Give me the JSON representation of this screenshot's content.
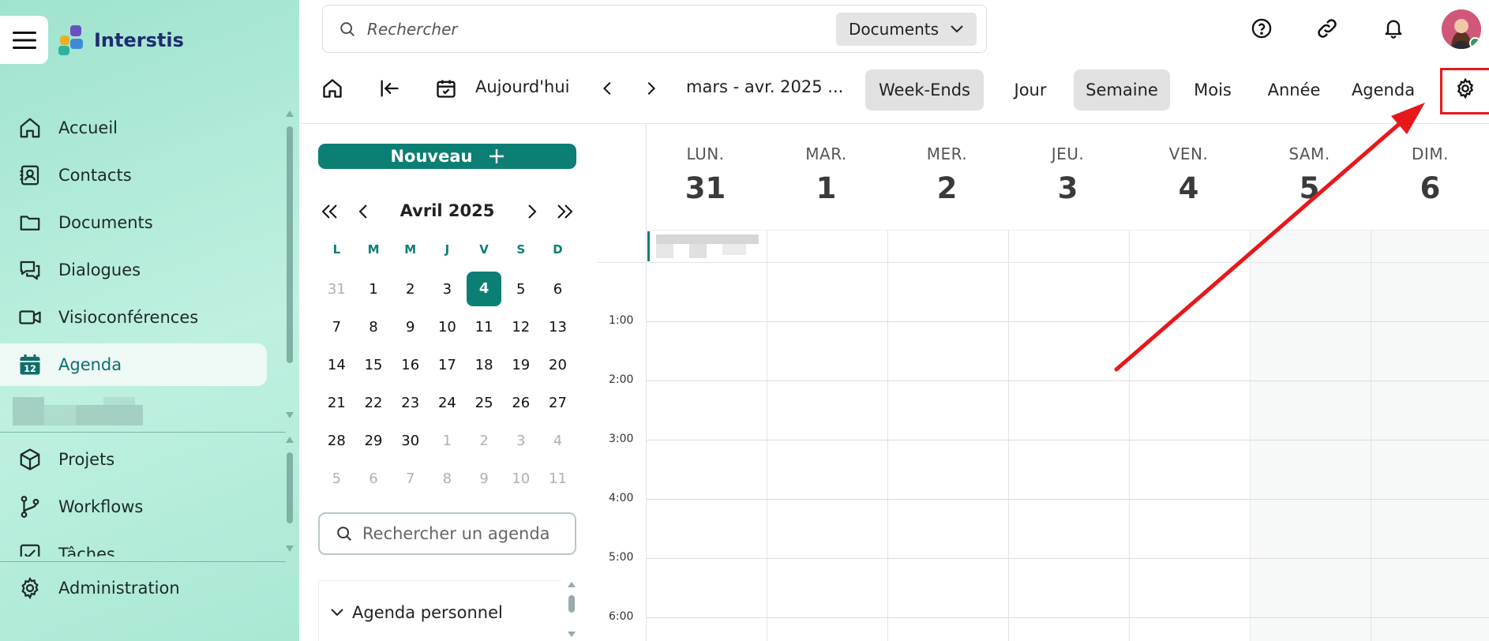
{
  "app": {
    "name": "Interstis"
  },
  "search": {
    "placeholder": "Rechercher",
    "scope": "Documents"
  },
  "sidebar": {
    "items": [
      {
        "label": "Accueil",
        "icon": "home-icon"
      },
      {
        "label": "Contacts",
        "icon": "contacts-icon"
      },
      {
        "label": "Documents",
        "icon": "folder-icon"
      },
      {
        "label": "Dialogues",
        "icon": "chat-icon"
      },
      {
        "label": "Visioconférences",
        "icon": "video-icon"
      },
      {
        "label": "Agenda",
        "icon": "calendar-icon",
        "active": true
      }
    ],
    "items2": [
      {
        "label": "Projets",
        "icon": "cube-icon"
      },
      {
        "label": "Workflows",
        "icon": "workflow-icon"
      },
      {
        "label": "Tâches",
        "icon": "task-icon"
      }
    ],
    "admin": {
      "label": "Administration",
      "icon": "gear-icon"
    },
    "calendar_icon_day": "12"
  },
  "toolbar": {
    "today": "Aujourd'hui",
    "range": "mars - avr. 2025 ...",
    "weekends": "Week-Ends",
    "views": [
      "Jour",
      "Semaine",
      "Mois",
      "Année",
      "Agenda"
    ],
    "active_view": "Semaine"
  },
  "mini_calendar": {
    "new_label": "Nouveau",
    "title": "Avril 2025",
    "dow": [
      "L",
      "M",
      "M",
      "J",
      "V",
      "S",
      "D"
    ],
    "weeks": [
      [
        "31",
        "1",
        "2",
        "3",
        "4",
        "5",
        "6"
      ],
      [
        "7",
        "8",
        "9",
        "10",
        "11",
        "12",
        "13"
      ],
      [
        "14",
        "15",
        "16",
        "17",
        "18",
        "19",
        "20"
      ],
      [
        "21",
        "22",
        "23",
        "24",
        "25",
        "26",
        "27"
      ],
      [
        "28",
        "29",
        "30",
        "1",
        "2",
        "3",
        "4"
      ],
      [
        "5",
        "6",
        "7",
        "8",
        "9",
        "10",
        "11"
      ]
    ],
    "today": "4",
    "search_placeholder": "Rechercher un agenda",
    "personal_agenda": "Agenda personnel"
  },
  "week": {
    "days": [
      {
        "name": "LUN.",
        "num": "31"
      },
      {
        "name": "MAR.",
        "num": "1"
      },
      {
        "name": "MER.",
        "num": "2"
      },
      {
        "name": "JEU.",
        "num": "3"
      },
      {
        "name": "VEN.",
        "num": "4"
      },
      {
        "name": "SAM.",
        "num": "5"
      },
      {
        "name": "DIM.",
        "num": "6"
      }
    ],
    "hours": [
      "1:00",
      "2:00",
      "3:00",
      "4:00",
      "5:00",
      "6:00"
    ]
  },
  "colors": {
    "accent": "#0c7f74",
    "highlight": "#e8171a"
  }
}
